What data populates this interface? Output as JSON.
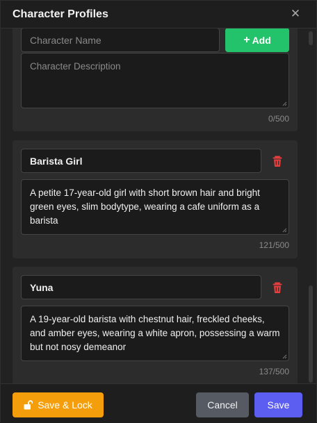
{
  "dialog": {
    "title": "Character Profiles",
    "close_icon": "close-icon"
  },
  "new_character": {
    "name_placeholder": "Character Name",
    "description_placeholder": "Character Description",
    "add_label": "Add",
    "counter": "0/500"
  },
  "characters": [
    {
      "name": "Barista Girl",
      "description": "A petite 17-year-old girl with short brown hair and bright green eyes, slim bodytype, wearing a cafe uniform as a barista",
      "counter": "121/500"
    },
    {
      "name": "Yuna",
      "description": "A 19-year-old barista with chestnut hair, freckled cheeks, and amber eyes, wearing a white apron, possessing a warm but not nosy demeanor",
      "counter": "137/500"
    }
  ],
  "footer": {
    "save_lock_label": "Save & Lock",
    "cancel_label": "Cancel",
    "save_label": "Save"
  },
  "colors": {
    "add": "#22c36a",
    "delete": "#e53e3e",
    "save_lock": "#f59e0b",
    "cancel": "#555a63",
    "save": "#5b5ef0"
  }
}
